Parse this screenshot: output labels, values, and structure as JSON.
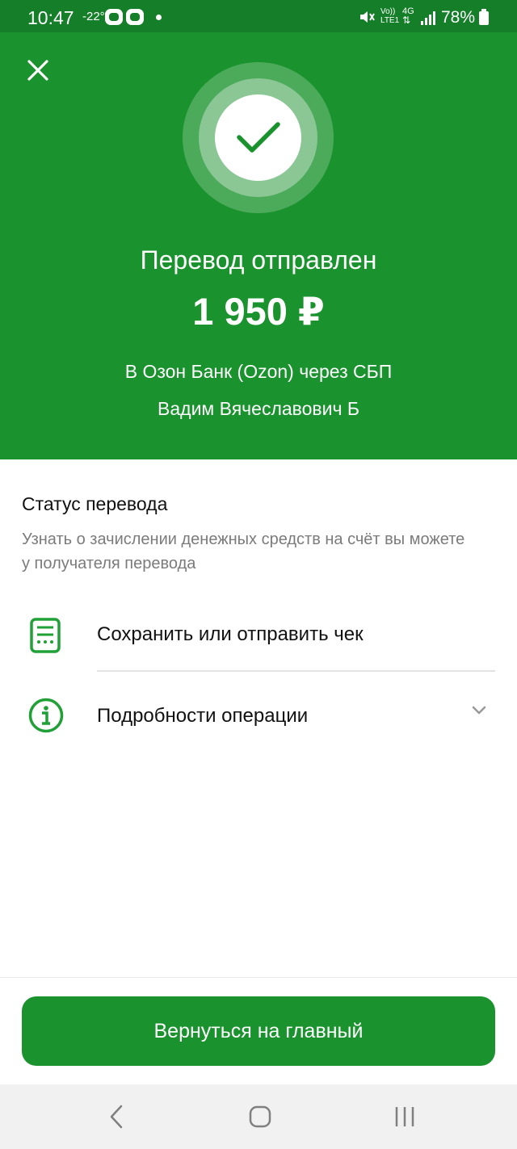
{
  "status_bar": {
    "time": "10:47",
    "temperature": "-22°",
    "network_vo": "Vo))",
    "network_lte": "LTE1",
    "network_4g": "4G",
    "battery": "78%"
  },
  "header": {
    "title": "Перевод отправлен",
    "amount": "1 950 ₽",
    "bank": "В Озон Банк (Ozon) через СБП",
    "recipient": "Вадим Вячеславович Б"
  },
  "status": {
    "title": "Статус перевода",
    "description": "Узнать о зачислении денежных средств на счёт вы можете у получателя перевода"
  },
  "actions": [
    {
      "label": "Сохранить или отправить чек",
      "icon": "receipt-icon"
    },
    {
      "label": "Подробности операции",
      "icon": "info-icon"
    }
  ],
  "main_button": {
    "label": "Вернуться на главный"
  },
  "navigation": [
    "back-icon",
    "home-icon",
    "recents-icon"
  ],
  "colors": {
    "brand_green": "#1a922e",
    "status_bar_green": "#147e29",
    "icon_green": "#21a038",
    "secondary_text": "#7b7b7b"
  }
}
